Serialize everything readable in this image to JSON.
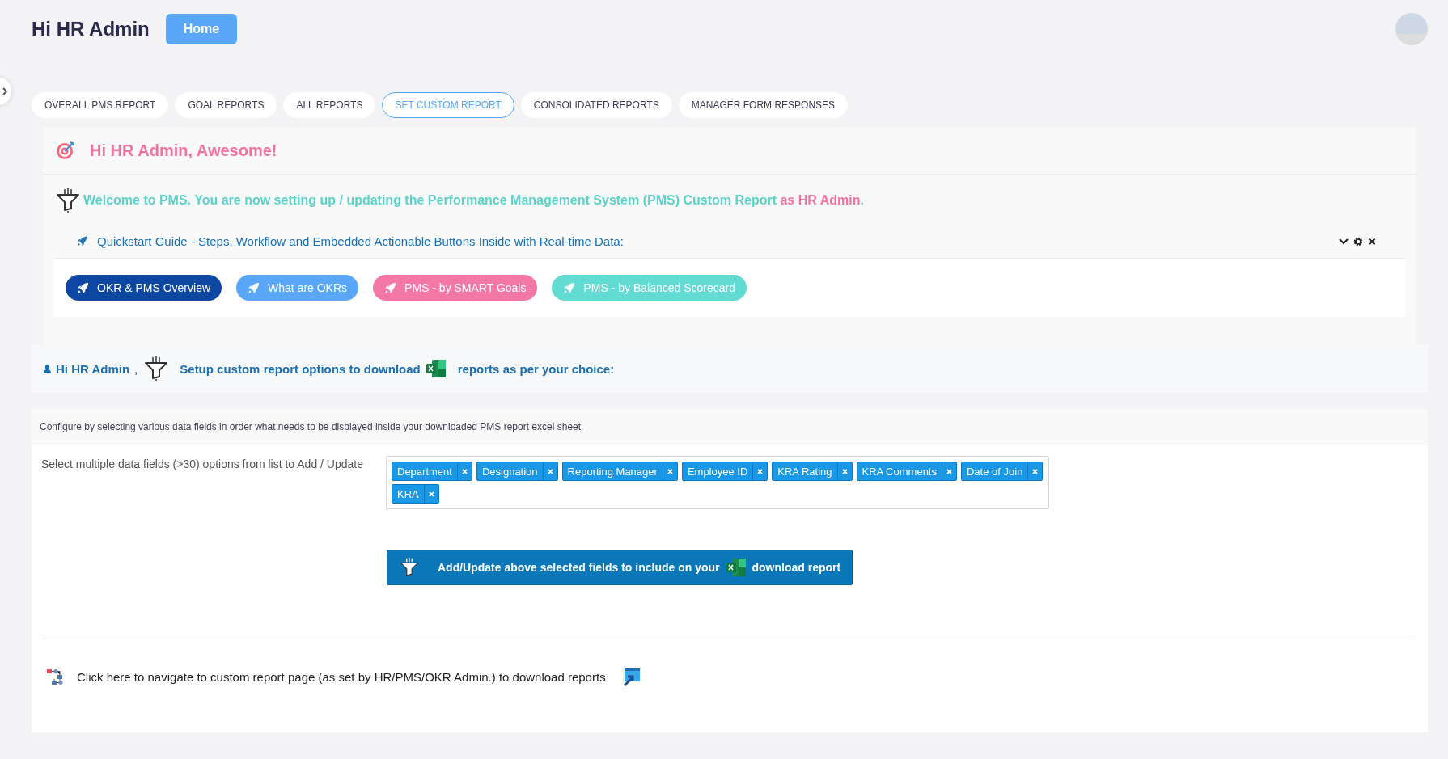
{
  "header": {
    "greeting": "Hi HR Admin",
    "home_button": "Home"
  },
  "tabs": [
    {
      "label": "OVERALL PMS REPORT",
      "selected": false
    },
    {
      "label": "GOAL REPORTS",
      "selected": false
    },
    {
      "label": "ALL REPORTS",
      "selected": false
    },
    {
      "label": "SET CUSTOM REPORT",
      "selected": true
    },
    {
      "label": "CONSOLIDATED REPORTS",
      "selected": false
    },
    {
      "label": "MANAGER FORM RESPONSES",
      "selected": false
    }
  ],
  "welcome_card": {
    "title": "Hi HR Admin, Awesome!",
    "message": "Welcome to PMS. You are now setting up / updating the Performance Management System (PMS) Custom Report **as HR Admin**.",
    "guide_title": "Quickstart Guide - Steps, Workflow and Embedded Actionable Buttons Inside with Real-time Data:",
    "guide_buttons": [
      {
        "label": "OKR & PMS Overview",
        "color": "#0d47a1"
      },
      {
        "label": "What are OKRs",
        "color": "#5aa7f9"
      },
      {
        "label": "PMS - by SMART Goals",
        "color": "#f478a6"
      },
      {
        "label": "PMS - by Balanced Scorecard",
        "color": "#62dbd3"
      }
    ]
  },
  "setup_bar": {
    "user": "Hi HR Admin",
    "separator": ",",
    "text_before": "Setup custom report options to download",
    "text_after": "reports as per your choice:"
  },
  "config": {
    "description": "Configure by selecting various data fields in order what needs to be displayed inside your downloaded PMS report excel sheet.",
    "field_label": "Select multiple data fields (>30) options from list to Add / Update",
    "selected_fields": [
      "Department",
      "Designation",
      "Reporting Manager",
      "Employee ID",
      "KRA Rating",
      "KRA Comments",
      "Date of Join",
      "KRA"
    ],
    "submit_before": "Add/Update above selected fields to include on your",
    "submit_after": "download report"
  },
  "footer_link": "Click here to navigate to custom report page (as set by HR/PMS/OKR Admin.) to download reports"
}
